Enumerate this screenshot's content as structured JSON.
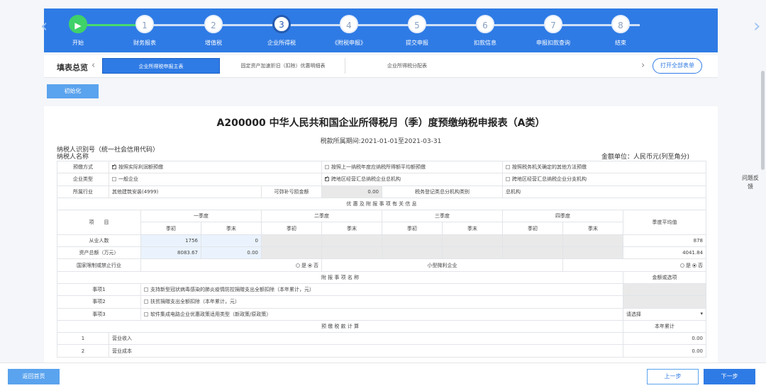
{
  "steps": [
    {
      "num": "▶",
      "label": "开始"
    },
    {
      "num": "1",
      "label": "财务报表"
    },
    {
      "num": "2",
      "label": "增值税"
    },
    {
      "num": "3",
      "label": "企业所得税"
    },
    {
      "num": "4",
      "label": "《附税申报》"
    },
    {
      "num": "5",
      "label": "提交申报"
    },
    {
      "num": "6",
      "label": "扣款信息"
    },
    {
      "num": "7",
      "label": "申报扣款查询"
    },
    {
      "num": "8",
      "label": "结束"
    }
  ],
  "tabs": {
    "title": "填表总览",
    "items": [
      "企业所得税申报主表",
      "固定资产加速折旧（扣除）优惠明细表",
      "企业所得税分配表"
    ],
    "open_all": "打开全部表单"
  },
  "init_button": "初始化",
  "form": {
    "title": "A200000 中华人民共和国企业所得税月（季）度预缴纳税申报表（A类）",
    "period": "税款所属期间:2021-01-01至2021-03-31",
    "taxpayer_id_label": "纳税人识别号（统一社会信用代码）",
    "taxpayer_name_label": "纳税人名称",
    "unit": "金额单位：人民币元(列至角分)",
    "row_prepay": {
      "label": "预缴方式",
      "opt1": "按照实际利润额预缴",
      "opt2": "按照上一纳税年度应纳税所得额平均额预缴",
      "opt3": "按照税务机关确定的其他方法预缴"
    },
    "row_type": {
      "label": "企业类型",
      "opt1": "一般企业",
      "opt2": "跨地区经营汇总纳税企业总机构",
      "opt3": "跨地区经营汇总纳税企业分支机构"
    },
    "row_industry": {
      "label": "所属行业",
      "value": "其他建筑安装(4999)",
      "subsidy_label": "可弥补亏损金额",
      "subsidy_value": "0.00",
      "reg_label": "税务登记类总分机构类别",
      "reg_value": "总机构"
    },
    "section_prefer": "优 惠 及 附 报 事 项 有 关 信 息",
    "col_item": "项　　目",
    "quarters": [
      "一季度",
      "二季度",
      "三季度",
      "四季度"
    ],
    "q_start": "季初",
    "q_end": "季末",
    "avg": "季度平均值",
    "employees": {
      "label": "从业人数",
      "q1_start": "1756",
      "q1_end": "0",
      "avg": "878"
    },
    "assets": {
      "label": "资产总额（万元）",
      "q1_start": "8083.67",
      "q1_end": "0.00",
      "avg": "4041.84"
    },
    "restricted": {
      "label": "国家限制或禁止行业",
      "yes": "是",
      "no": "否",
      "small_label": "小型微利企业",
      "small_yes": "是",
      "small_no": "否"
    },
    "section_attach": "附 报 事 项 名 称",
    "amount_or_option": "金额或选项",
    "items": [
      {
        "label": "事项1",
        "text": "支持新型冠状病毒感染的肺炎疫情防控捐赠支出全额扣除（本年累计，元）"
      },
      {
        "label": "事项2",
        "text": "扶贫捐赠支出全额扣除（本年累计，元）"
      },
      {
        "label": "事项3",
        "text": "软件集成电路企业优惠政策适用类型（新政策/原政策）"
      }
    ],
    "select_placeholder": "请选择",
    "section_calc": "预 缴 税 款 计 算",
    "ytd": "本年累计",
    "calc_rows": [
      {
        "num": "1",
        "label": "营业收入",
        "value": "0.00"
      },
      {
        "num": "2",
        "label": "营业成本",
        "value": "0.00"
      }
    ]
  },
  "feedback": "问题反馈",
  "bottom": {
    "home": "返回首页",
    "prev": "上一步",
    "next": "下一步"
  }
}
